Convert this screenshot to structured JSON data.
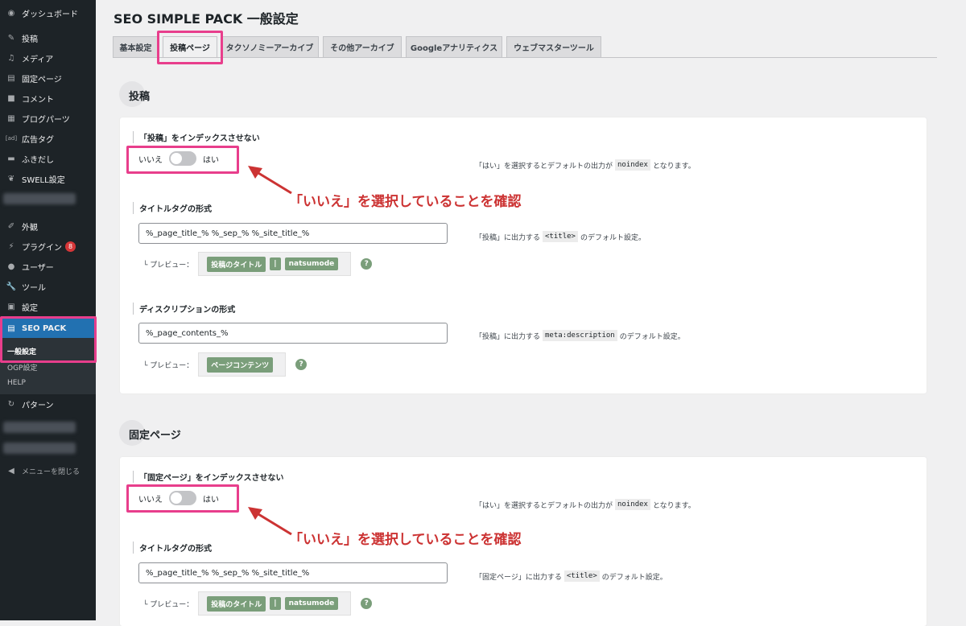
{
  "sidebar": {
    "items": [
      {
        "label": "ダッシュボード",
        "icon": "dashboard-icon"
      },
      {
        "label": "投稿",
        "icon": "pin-icon"
      },
      {
        "label": "メディア",
        "icon": "media-icon"
      },
      {
        "label": "固定ページ",
        "icon": "page-icon"
      },
      {
        "label": "コメント",
        "icon": "comment-icon"
      },
      {
        "label": "ブログパーツ",
        "icon": "blocks-icon"
      },
      {
        "label": "広告タグ",
        "icon": "ad-icon"
      },
      {
        "label": "ふきだし",
        "icon": "bubble-icon"
      },
      {
        "label": "SWELL設定",
        "icon": "swell-icon"
      },
      {
        "label": "外観",
        "icon": "appearance-icon"
      },
      {
        "label": "プラグイン",
        "icon": "plugin-icon",
        "badge": "8"
      },
      {
        "label": "ユーザー",
        "icon": "user-icon"
      },
      {
        "label": "ツール",
        "icon": "tool-icon"
      },
      {
        "label": "設定",
        "icon": "settings-icon"
      },
      {
        "label": "SEO PACK",
        "icon": "seo-pack-icon"
      },
      {
        "label": "パターン",
        "icon": "pattern-icon"
      },
      {
        "label": "メニューを閉じる",
        "icon": "collapse-icon"
      }
    ],
    "submenu": [
      "一般設定",
      "OGP設定",
      "HELP"
    ]
  },
  "page": {
    "title": "SEO SIMPLE PACK 一般設定",
    "tabs": [
      "基本設定",
      "投稿ページ",
      "タクソノミーアーカイブ",
      "その他アーカイブ",
      "Googleアナリティクス",
      "ウェブマスターツール"
    ]
  },
  "sections": [
    {
      "heading": "投稿",
      "noindex_label": "「投稿」をインデックスさせない",
      "toggle_off": "いいえ",
      "toggle_on": "はい",
      "noindex_help_pre": "「はい」を選択するとデフォルトの出力が",
      "noindex_help_code": "noindex",
      "noindex_help_post": "となります。",
      "title_label": "タイトルタグの形式",
      "title_value": "%_page_title_% %_sep_% %_site_title_%",
      "title_help_pre": "「投稿」に出力する",
      "title_help_code": "<title>",
      "title_help_post": "のデフォルト設定。",
      "preview_label": "└ プレビュー：",
      "title_preview": [
        "投稿のタイトル",
        "|",
        "natsumode"
      ],
      "desc_label": "ディスクリプションの形式",
      "desc_value": "%_page_contents_%",
      "desc_help_pre": "「投稿」に出力する",
      "desc_help_code": "meta:description",
      "desc_help_post": "のデフォルト設定。",
      "desc_preview": [
        "ページコンテンツ"
      ],
      "qmark": "?"
    },
    {
      "heading": "固定ページ",
      "noindex_label": "「固定ページ」をインデックスさせない",
      "toggle_off": "いいえ",
      "toggle_on": "はい",
      "noindex_help_pre": "「はい」を選択するとデフォルトの出力が",
      "noindex_help_code": "noindex",
      "noindex_help_post": "となります。",
      "title_label": "タイトルタグの形式",
      "title_value": "%_page_title_% %_sep_% %_site_title_%",
      "title_help_pre": "「固定ページ」に出力する",
      "title_help_code": "<title>",
      "title_help_post": "のデフォルト設定。",
      "preview_label": "└ プレビュー：",
      "title_preview": [
        "投稿のタイトル",
        "|",
        "natsumode"
      ],
      "qmark": "?"
    }
  ],
  "annotations": [
    "「いいえ」を選択していることを確認",
    "「いいえ」を選択していることを確認"
  ],
  "colors": {
    "sidebar": "#1d2327",
    "accent": "#2271b1",
    "highlight": "#e83e8c",
    "annotation": "#cc3333",
    "preview_chip": "#7a9e7a"
  }
}
